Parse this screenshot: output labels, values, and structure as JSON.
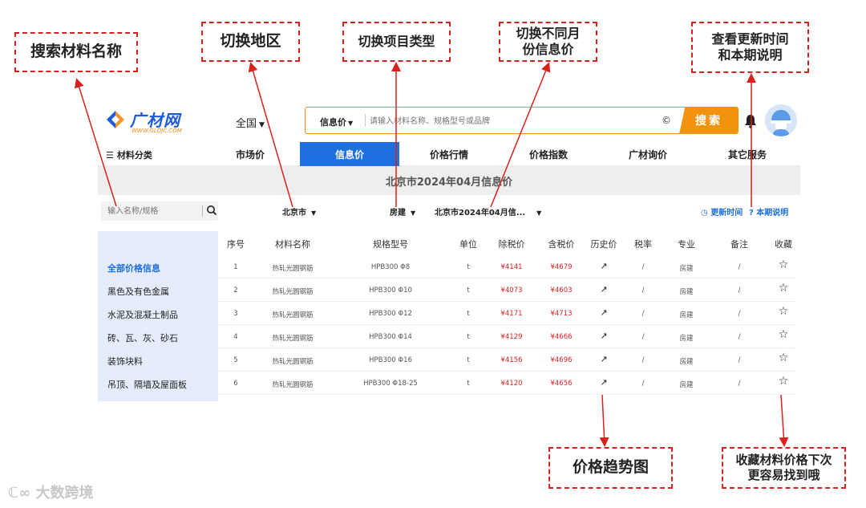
{
  "annotations": {
    "search_material": "搜索材料名称",
    "switch_region": "切换地区",
    "switch_project_type": "切换项目类型",
    "switch_month": "切换不同月\n份信息价",
    "check_update": "查看更新时间\n和本期说明",
    "price_trend": "价格趋势图",
    "favorite": "收藏材料价格下次\n更容易找到哦"
  },
  "header": {
    "logo_name": "广材网",
    "logo_url": "WWW.GLDJC.COM",
    "region": "全国",
    "search_type": "信息价",
    "search_placeholder": "请输入材料名称、规格型号或品牌",
    "clear_symbol": "©",
    "search_button": "搜索"
  },
  "nav": {
    "category": "材料分类",
    "items": [
      "市场价",
      "信息价",
      "价格行情",
      "价格指数",
      "广材询价",
      "其它服务"
    ],
    "active_index": 1
  },
  "banner_title": "北京市2024年04月信息价",
  "filters": {
    "search_placeholder": "输入名称/规格",
    "city": "北京市",
    "project_type": "房建",
    "period": "北京市2024年04月信...",
    "update_time": "更新时间",
    "period_note": "本期说明"
  },
  "sidebar": {
    "items": [
      "全部价格信息",
      "黑色及有色金属",
      "水泥及混凝土制品",
      "砖、瓦、灰、砂石",
      "装饰块料",
      "吊顶、隔墙及屋面板"
    ],
    "active_index": 0
  },
  "table": {
    "columns": [
      "序号",
      "材料名称",
      "规格型号",
      "单位",
      "除税价",
      "含税价",
      "历史价",
      "税率",
      "专业",
      "备注",
      "收藏"
    ],
    "rows": [
      {
        "no": "1",
        "name": "热轧光圆钢筋",
        "spec": "HPB300 Φ8",
        "unit": "t",
        "price_ex": "¥4141",
        "price_in": "¥4679",
        "tax": "/",
        "major": "房建",
        "note": "/"
      },
      {
        "no": "2",
        "name": "热轧光圆钢筋",
        "spec": "HPB300 Φ10",
        "unit": "t",
        "price_ex": "¥4073",
        "price_in": "¥4603",
        "tax": "/",
        "major": "房建",
        "note": "/"
      },
      {
        "no": "3",
        "name": "热轧光圆钢筋",
        "spec": "HPB300 Φ12",
        "unit": "t",
        "price_ex": "¥4171",
        "price_in": "¥4713",
        "tax": "/",
        "major": "房建",
        "note": "/"
      },
      {
        "no": "4",
        "name": "热轧光圆钢筋",
        "spec": "HPB300 Φ14",
        "unit": "t",
        "price_ex": "¥4129",
        "price_in": "¥4666",
        "tax": "/",
        "major": "房建",
        "note": "/"
      },
      {
        "no": "5",
        "name": "热轧光圆钢筋",
        "spec": "HPB300 Φ16",
        "unit": "t",
        "price_ex": "¥4156",
        "price_in": "¥4696",
        "tax": "/",
        "major": "房建",
        "note": "/"
      },
      {
        "no": "6",
        "name": "热轧光圆钢筋",
        "spec": "HPB300 Φ18-25",
        "unit": "t",
        "price_ex": "¥4120",
        "price_in": "¥4656",
        "tax": "/",
        "major": "房建",
        "note": "/"
      }
    ]
  },
  "watermark": "大数跨境",
  "colors": {
    "accent": "#1e6fe0",
    "orange": "#f29310",
    "annotation": "#d9221c",
    "price": "#e02020"
  }
}
